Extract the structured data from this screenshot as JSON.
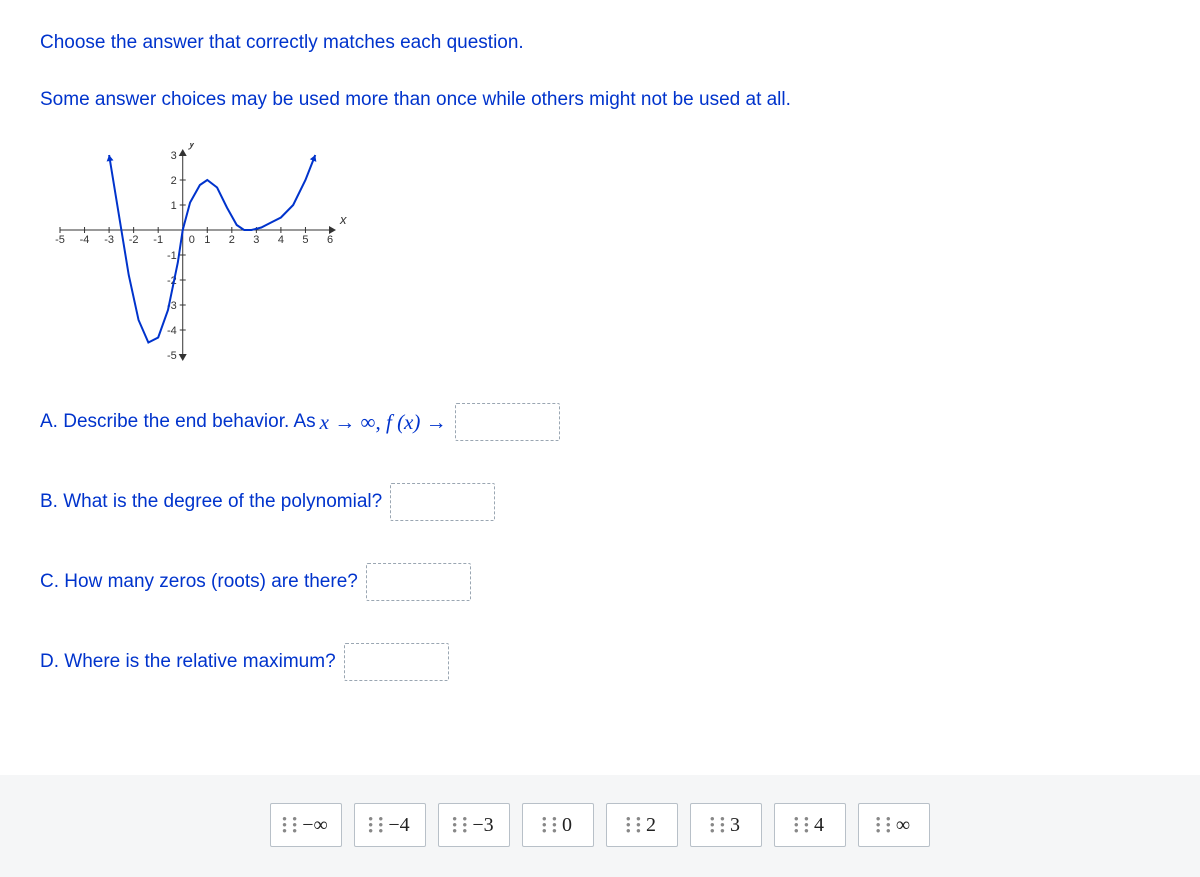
{
  "intro": {
    "line1": "Choose the answer that correctly matches each question.",
    "line2": "Some answer choices may be used more than once while others might not be used at all."
  },
  "questions": {
    "A": {
      "prefix": "A. Describe the end behavior. As ",
      "math_x": "x",
      "math_arrow1": " → ∞, ",
      "math_fx": "f (x)",
      "math_arrow2": " →"
    },
    "B": {
      "text": "B. What is the degree of the polynomial?"
    },
    "C": {
      "text": "C. How many zeros (roots) are there?"
    },
    "D": {
      "text": "D. Where is the relative maximum?"
    }
  },
  "answer_tiles": [
    "−∞",
    "−4",
    "−3",
    "0",
    "2",
    "3",
    "4",
    "∞"
  ],
  "chart_data": {
    "type": "line",
    "xlabel": "x",
    "ylabel": "y",
    "xlim": [
      -5,
      6
    ],
    "ylim": [
      -5,
      3
    ],
    "x_ticks": [
      -5,
      -4,
      -3,
      -2,
      -1,
      0,
      1,
      2,
      3,
      4,
      5,
      6
    ],
    "y_ticks": [
      -5,
      -4,
      -3,
      -2,
      -1,
      0,
      1,
      2,
      3
    ],
    "sampled_points": [
      {
        "x": -3.0,
        "y": 3.0
      },
      {
        "x": -2.8,
        "y": 1.8
      },
      {
        "x": -2.5,
        "y": 0.0
      },
      {
        "x": -2.2,
        "y": -1.8
      },
      {
        "x": -1.8,
        "y": -3.6
      },
      {
        "x": -1.4,
        "y": -4.5
      },
      {
        "x": -1.0,
        "y": -4.3
      },
      {
        "x": -0.6,
        "y": -3.2
      },
      {
        "x": -0.2,
        "y": -1.3
      },
      {
        "x": 0.0,
        "y": 0.0
      },
      {
        "x": 0.3,
        "y": 1.1
      },
      {
        "x": 0.7,
        "y": 1.8
      },
      {
        "x": 1.0,
        "y": 2.0
      },
      {
        "x": 1.4,
        "y": 1.7
      },
      {
        "x": 1.8,
        "y": 0.9
      },
      {
        "x": 2.2,
        "y": 0.2
      },
      {
        "x": 2.5,
        "y": 0.0
      },
      {
        "x": 2.8,
        "y": 0.0
      },
      {
        "x": 3.2,
        "y": 0.1
      },
      {
        "x": 3.6,
        "y": 0.3
      },
      {
        "x": 4.0,
        "y": 0.5
      },
      {
        "x": 4.5,
        "y": 1.0
      },
      {
        "x": 5.0,
        "y": 2.0
      },
      {
        "x": 5.4,
        "y": 3.0
      }
    ]
  }
}
